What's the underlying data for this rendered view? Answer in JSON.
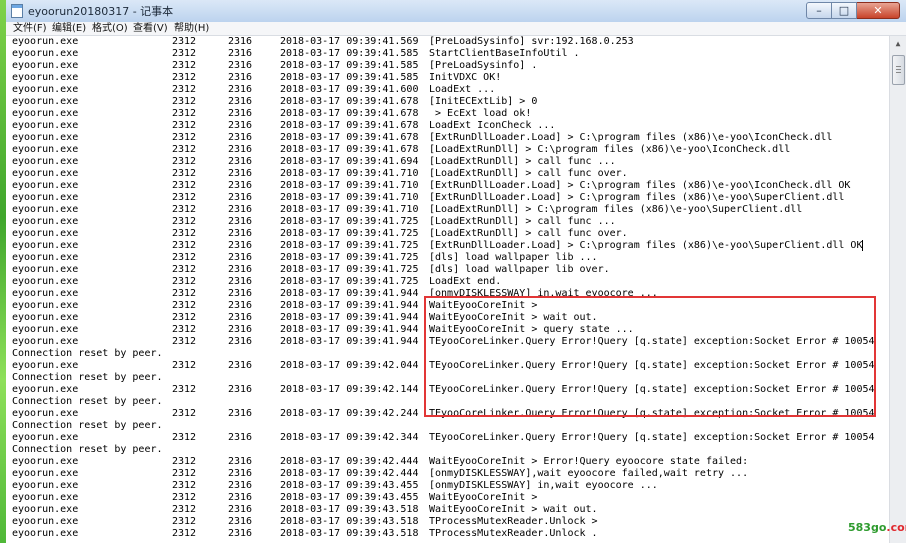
{
  "window": {
    "title": "eyoorun20180317 - 记事本",
    "buttons": {
      "minimize": "–",
      "maximize": "□",
      "close": "✕"
    }
  },
  "menu": [
    "文件(F)",
    "编辑(E)",
    "格式(O)",
    "查看(V)",
    "帮助(H)"
  ],
  "log_lines": [
    {
      "exe": "eyoorun.exe",
      "pid": "2312",
      "tid": "2316",
      "ts": "2018-03-17 09:39:41.569",
      "msg": "[PreLoadSysinfo] svr:192.168.0.253"
    },
    {
      "exe": "eyoorun.exe",
      "pid": "2312",
      "tid": "2316",
      "ts": "2018-03-17 09:39:41.585",
      "msg": "StartClientBaseInfoUtil ."
    },
    {
      "exe": "eyoorun.exe",
      "pid": "2312",
      "tid": "2316",
      "ts": "2018-03-17 09:39:41.585",
      "msg": "[PreLoadSysinfo] ."
    },
    {
      "exe": "eyoorun.exe",
      "pid": "2312",
      "tid": "2316",
      "ts": "2018-03-17 09:39:41.585",
      "msg": "InitVDXC OK!"
    },
    {
      "exe": "eyoorun.exe",
      "pid": "2312",
      "tid": "2316",
      "ts": "2018-03-17 09:39:41.600",
      "msg": "LoadExt ..."
    },
    {
      "exe": "eyoorun.exe",
      "pid": "2312",
      "tid": "2316",
      "ts": "2018-03-17 09:39:41.678",
      "msg": "[InitECExtLib] > 0"
    },
    {
      "exe": "eyoorun.exe",
      "pid": "2312",
      "tid": "2316",
      "ts": "2018-03-17 09:39:41.678",
      "msg": " > EcExt load ok!"
    },
    {
      "exe": "eyoorun.exe",
      "pid": "2312",
      "tid": "2316",
      "ts": "2018-03-17 09:39:41.678",
      "msg": "LoadExt IconCheck ..."
    },
    {
      "exe": "eyoorun.exe",
      "pid": "2312",
      "tid": "2316",
      "ts": "2018-03-17 09:39:41.678",
      "msg": "[ExtRunDllLoader.Load] > C:\\program files (x86)\\e-yoo\\IconCheck.dll"
    },
    {
      "exe": "eyoorun.exe",
      "pid": "2312",
      "tid": "2316",
      "ts": "2018-03-17 09:39:41.678",
      "msg": "[LoadExtRunDll] > C:\\program files (x86)\\e-yoo\\IconCheck.dll"
    },
    {
      "exe": "eyoorun.exe",
      "pid": "2312",
      "tid": "2316",
      "ts": "2018-03-17 09:39:41.694",
      "msg": "[LoadExtRunDll] > call func ..."
    },
    {
      "exe": "eyoorun.exe",
      "pid": "2312",
      "tid": "2316",
      "ts": "2018-03-17 09:39:41.710",
      "msg": "[LoadExtRunDll] > call func over."
    },
    {
      "exe": "eyoorun.exe",
      "pid": "2312",
      "tid": "2316",
      "ts": "2018-03-17 09:39:41.710",
      "msg": "[ExtRunDllLoader.Load] > C:\\program files (x86)\\e-yoo\\IconCheck.dll OK"
    },
    {
      "exe": "eyoorun.exe",
      "pid": "2312",
      "tid": "2316",
      "ts": "2018-03-17 09:39:41.710",
      "msg": "[ExtRunDllLoader.Load] > C:\\program files (x86)\\e-yoo\\SuperClient.dll"
    },
    {
      "exe": "eyoorun.exe",
      "pid": "2312",
      "tid": "2316",
      "ts": "2018-03-17 09:39:41.710",
      "msg": "[LoadExtRunDll] > C:\\program files (x86)\\e-yoo\\SuperClient.dll"
    },
    {
      "exe": "eyoorun.exe",
      "pid": "2312",
      "tid": "2316",
      "ts": "2018-03-17 09:39:41.725",
      "msg": "[LoadExtRunDll] > call func ..."
    },
    {
      "exe": "eyoorun.exe",
      "pid": "2312",
      "tid": "2316",
      "ts": "2018-03-17 09:39:41.725",
      "msg": "[LoadExtRunDll] > call func over."
    },
    {
      "exe": "eyoorun.exe",
      "pid": "2312",
      "tid": "2316",
      "ts": "2018-03-17 09:39:41.725",
      "msg": "[ExtRunDllLoader.Load] > C:\\program files (x86)\\e-yoo\\SuperClient.dll OK",
      "caret": true
    },
    {
      "exe": "eyoorun.exe",
      "pid": "2312",
      "tid": "2316",
      "ts": "2018-03-17 09:39:41.725",
      "msg": "[dls] load wallpaper lib ..."
    },
    {
      "exe": "eyoorun.exe",
      "pid": "2312",
      "tid": "2316",
      "ts": "2018-03-17 09:39:41.725",
      "msg": "[dls] load wallpaper lib over."
    },
    {
      "exe": "eyoorun.exe",
      "pid": "2312",
      "tid": "2316",
      "ts": "2018-03-17 09:39:41.725",
      "msg": "LoadExt end."
    },
    {
      "exe": "eyoorun.exe",
      "pid": "2312",
      "tid": "2316",
      "ts": "2018-03-17 09:39:41.944",
      "msg": "[onmyDISKLESSWAY] in,wait eyoocore ..."
    },
    {
      "exe": "eyoorun.exe",
      "pid": "2312",
      "tid": "2316",
      "ts": "2018-03-17 09:39:41.944",
      "msg": "WaitEyooCoreInit >"
    },
    {
      "exe": "eyoorun.exe",
      "pid": "2312",
      "tid": "2316",
      "ts": "2018-03-17 09:39:41.944",
      "msg": "WaitEyooCoreInit > wait out."
    },
    {
      "exe": "eyoorun.exe",
      "pid": "2312",
      "tid": "2316",
      "ts": "2018-03-17 09:39:41.944",
      "msg": "WaitEyooCoreInit > query state ..."
    },
    {
      "exe": "eyoorun.exe",
      "pid": "2312",
      "tid": "2316",
      "ts": "2018-03-17 09:39:41.944",
      "msg": "TEyooCoreLinker.Query Error!Query [q.state] exception:Socket Error # 10054"
    },
    {
      "exe": "Connection reset by peer."
    },
    {
      "exe": "eyoorun.exe",
      "pid": "2312",
      "tid": "2316",
      "ts": "2018-03-17 09:39:42.044",
      "msg": "TEyooCoreLinker.Query Error!Query [q.state] exception:Socket Error # 10054"
    },
    {
      "exe": "Connection reset by peer."
    },
    {
      "exe": "eyoorun.exe",
      "pid": "2312",
      "tid": "2316",
      "ts": "2018-03-17 09:39:42.144",
      "msg": "TEyooCoreLinker.Query Error!Query [q.state] exception:Socket Error # 10054"
    },
    {
      "exe": "Connection reset by peer."
    },
    {
      "exe": "eyoorun.exe",
      "pid": "2312",
      "tid": "2316",
      "ts": "2018-03-17 09:39:42.244",
      "msg": "TEyooCoreLinker.Query Error!Query [q.state] exception:Socket Error # 10054"
    },
    {
      "exe": "Connection reset by peer."
    },
    {
      "exe": "eyoorun.exe",
      "pid": "2312",
      "tid": "2316",
      "ts": "2018-03-17 09:39:42.344",
      "msg": "TEyooCoreLinker.Query Error!Query [q.state] exception:Socket Error # 10054"
    },
    {
      "exe": "Connection reset by peer."
    },
    {
      "exe": "eyoorun.exe",
      "pid": "2312",
      "tid": "2316",
      "ts": "2018-03-17 09:39:42.444",
      "msg": "WaitEyooCoreInit > Error!Query eyoocore state failed:"
    },
    {
      "exe": "eyoorun.exe",
      "pid": "2312",
      "tid": "2316",
      "ts": "2018-03-17 09:39:42.444",
      "msg": "[onmyDISKLESSWAY],wait eyoocore failed,wait retry ..."
    },
    {
      "exe": "eyoorun.exe",
      "pid": "2312",
      "tid": "2316",
      "ts": "2018-03-17 09:39:43.455",
      "msg": "[onmyDISKLESSWAY] in,wait eyoocore ..."
    },
    {
      "exe": "eyoorun.exe",
      "pid": "2312",
      "tid": "2316",
      "ts": "2018-03-17 09:39:43.455",
      "msg": "WaitEyooCoreInit >"
    },
    {
      "exe": "eyoorun.exe",
      "pid": "2312",
      "tid": "2316",
      "ts": "2018-03-17 09:39:43.518",
      "msg": "WaitEyooCoreInit > wait out."
    },
    {
      "exe": "eyoorun.exe",
      "pid": "2312",
      "tid": "2316",
      "ts": "2018-03-17 09:39:43.518",
      "msg": "TProcessMutexReader.Unlock >"
    },
    {
      "exe": "eyoorun.exe",
      "pid": "2312",
      "tid": "2316",
      "ts": "2018-03-17 09:39:43.518",
      "msg": "TProcessMutexReader.Unlock ."
    }
  ],
  "watermark": {
    "green": "583go",
    "red": ".com"
  },
  "colors": {
    "highlight_border": "#e23636",
    "watermark_green": "#2e9b2e",
    "watermark_red": "#e0282d"
  }
}
